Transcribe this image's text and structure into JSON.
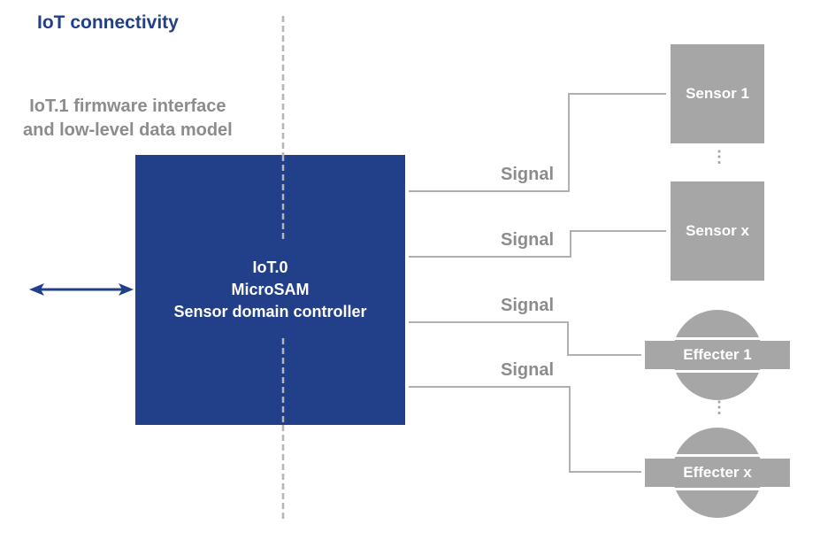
{
  "header": {
    "title": "IoT connectivity",
    "subtitle_line1": "IoT.1 firmware interface",
    "subtitle_line2": "and low-level data model"
  },
  "controller": {
    "line1": "IoT.0",
    "line2": "MicroSAM",
    "line3": "Sensor domain controller"
  },
  "signals": [
    {
      "label": "Signal",
      "target": "Sensor 1"
    },
    {
      "label": "Signal",
      "target": "Sensor x"
    },
    {
      "label": "Signal",
      "target": "Effecter 1"
    },
    {
      "label": "Signal",
      "target": "Effecter x"
    }
  ],
  "sensors": [
    {
      "label": "Sensor 1"
    },
    {
      "label": "Sensor x"
    }
  ],
  "effecters": [
    {
      "label": "Effecter 1"
    },
    {
      "label": "Effecter x"
    }
  ],
  "ellipsis_symbol": "⋮",
  "colors": {
    "brand_blue": "#223f8a",
    "gray_text": "#8c8c8c",
    "device_gray": "#a6a6a6",
    "line_gray": "#b0b0b0"
  }
}
